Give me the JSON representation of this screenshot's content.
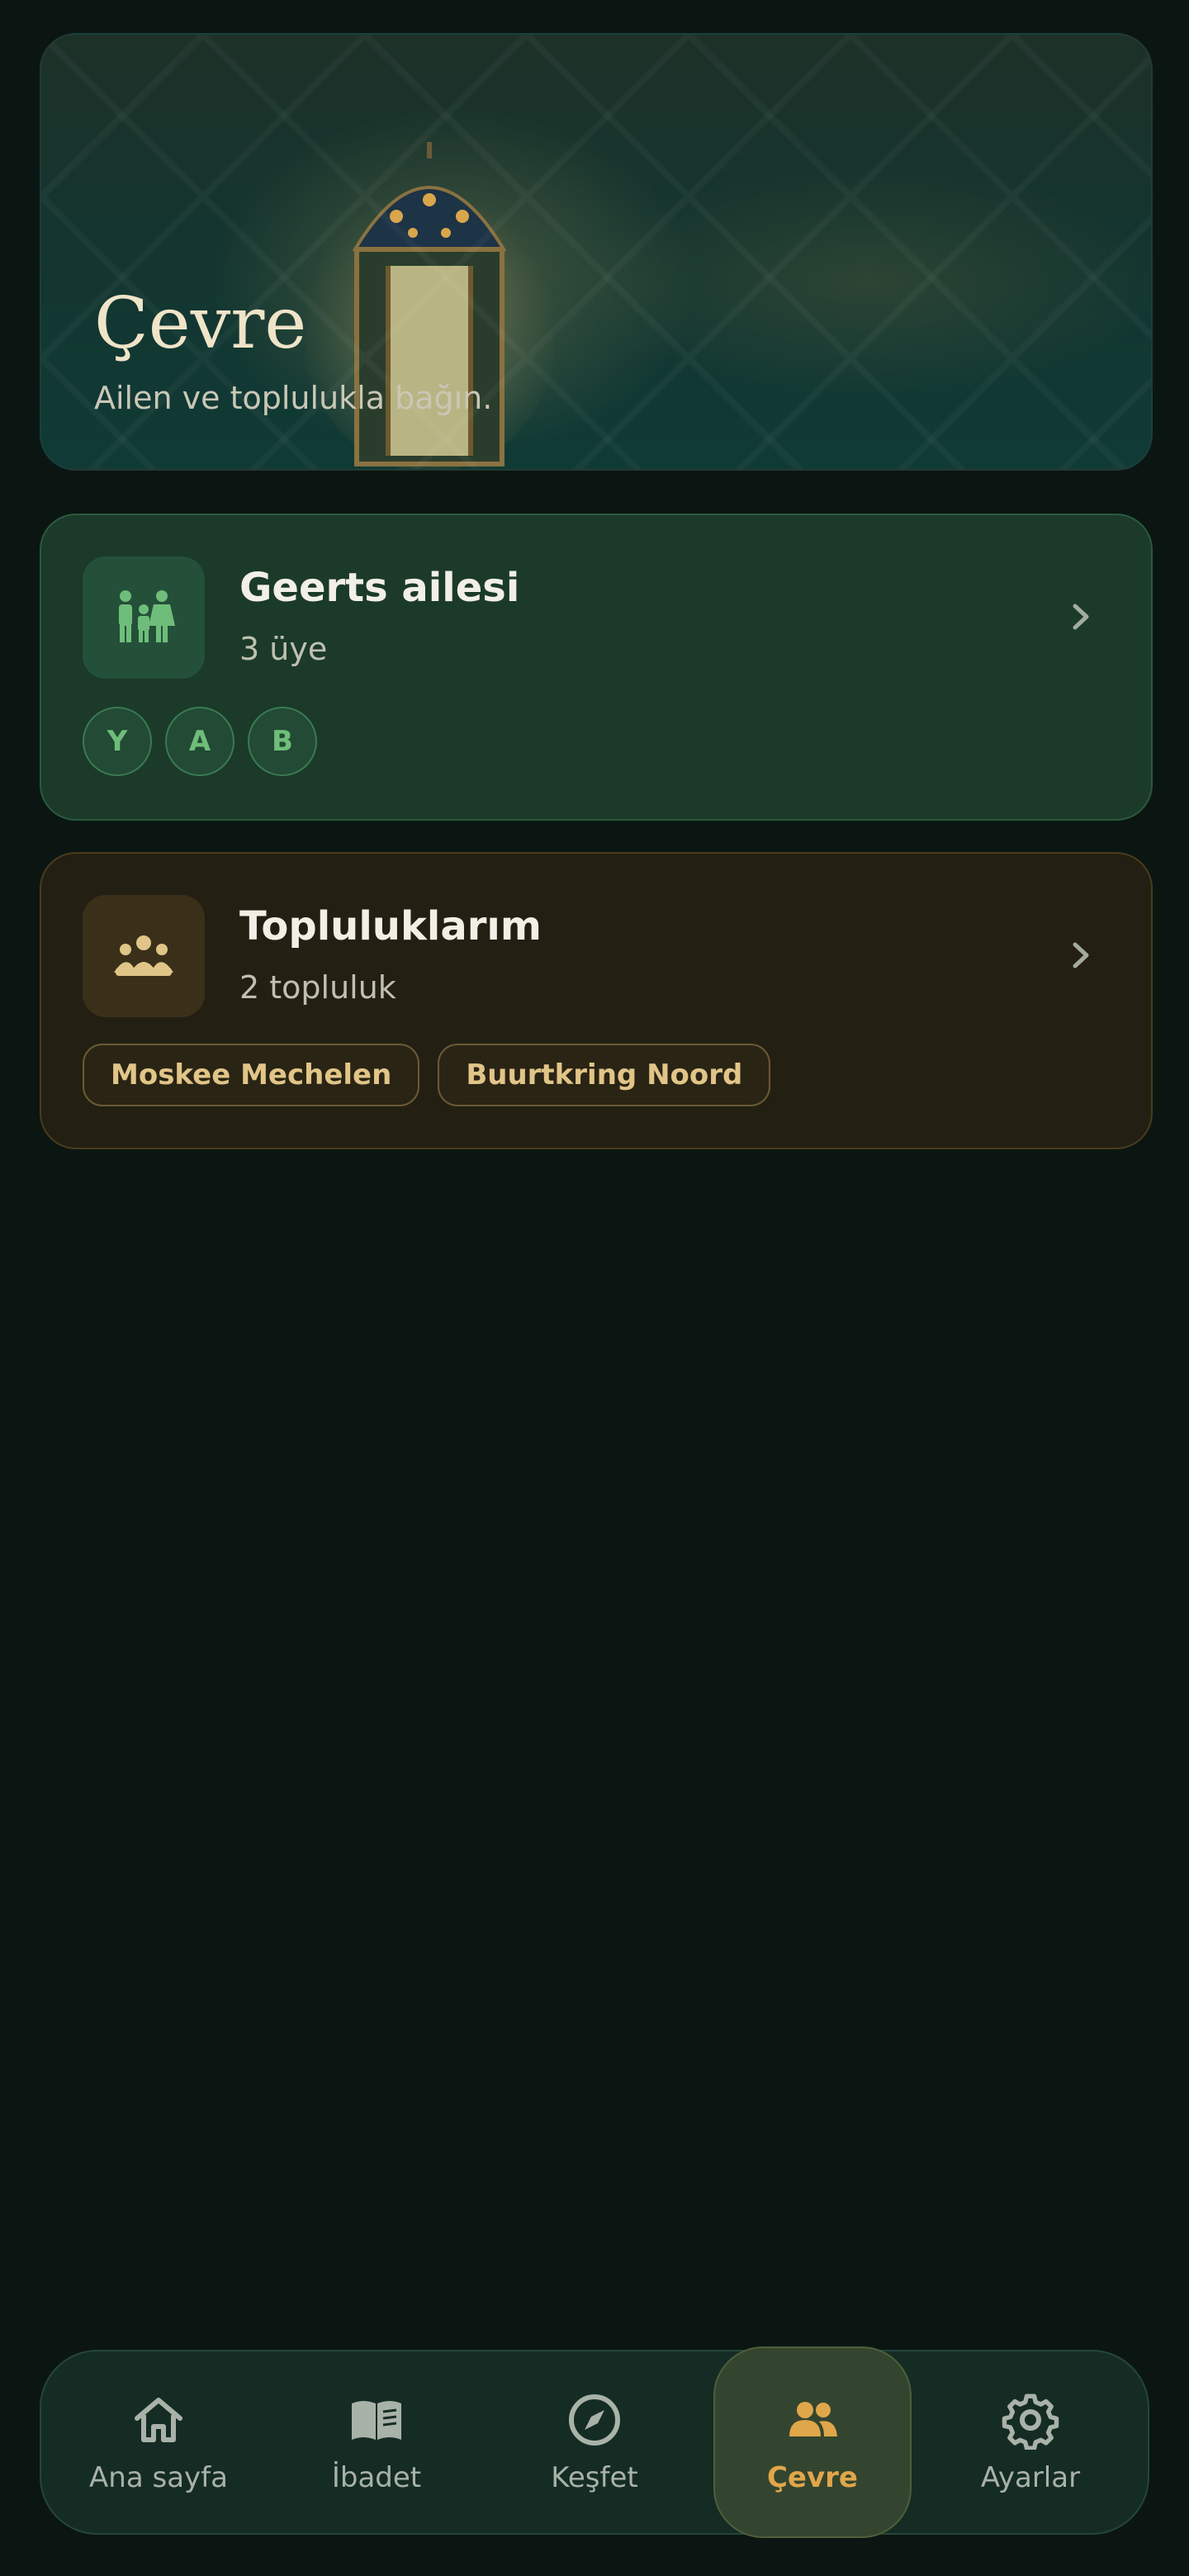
{
  "hero": {
    "title": "Çevre",
    "subtitle": "Ailen ve toplulukla bağın."
  },
  "family_card": {
    "title": "Geerts ailesi",
    "subtitle": "3 üye",
    "members": [
      "Y",
      "A",
      "B"
    ],
    "icon": "family-icon"
  },
  "community_card": {
    "title": "Topluluklarım",
    "subtitle": "2 topluluk",
    "communities": [
      "Moskee Mechelen",
      "Buurtkring Noord"
    ],
    "icon": "group-icon"
  },
  "nav": {
    "items": [
      {
        "label": "Ana sayfa",
        "icon": "home-icon",
        "active": false
      },
      {
        "label": "İbadet",
        "icon": "book-icon",
        "active": false
      },
      {
        "label": "Keşfet",
        "icon": "compass-icon",
        "active": false
      },
      {
        "label": "Çevre",
        "icon": "people-icon",
        "active": true
      },
      {
        "label": "Ayarlar",
        "icon": "gear-icon",
        "active": false
      }
    ]
  },
  "colors": {
    "background": "#0b1613",
    "family_accent": "#6fbd7a",
    "community_accent": "#e1c588",
    "nav_active": "#e0a64a"
  }
}
